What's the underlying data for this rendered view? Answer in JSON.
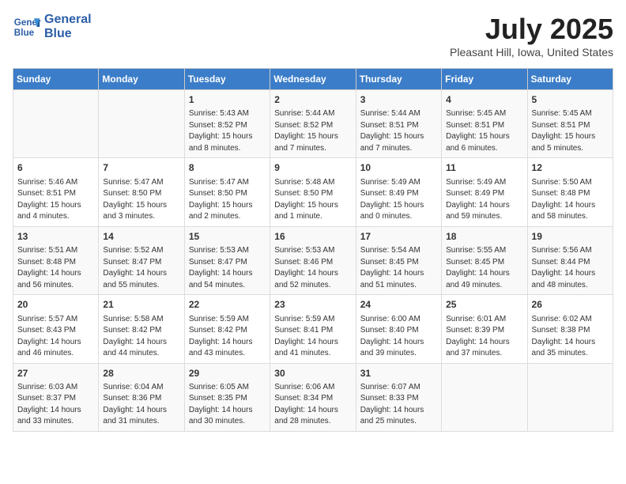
{
  "logo": {
    "line1": "General",
    "line2": "Blue"
  },
  "title": "July 2025",
  "location": "Pleasant Hill, Iowa, United States",
  "days_of_week": [
    "Sunday",
    "Monday",
    "Tuesday",
    "Wednesday",
    "Thursday",
    "Friday",
    "Saturday"
  ],
  "weeks": [
    [
      {
        "day": "",
        "info": ""
      },
      {
        "day": "",
        "info": ""
      },
      {
        "day": "1",
        "info": "Sunrise: 5:43 AM\nSunset: 8:52 PM\nDaylight: 15 hours and 8 minutes."
      },
      {
        "day": "2",
        "info": "Sunrise: 5:44 AM\nSunset: 8:52 PM\nDaylight: 15 hours and 7 minutes."
      },
      {
        "day": "3",
        "info": "Sunrise: 5:44 AM\nSunset: 8:51 PM\nDaylight: 15 hours and 7 minutes."
      },
      {
        "day": "4",
        "info": "Sunrise: 5:45 AM\nSunset: 8:51 PM\nDaylight: 15 hours and 6 minutes."
      },
      {
        "day": "5",
        "info": "Sunrise: 5:45 AM\nSunset: 8:51 PM\nDaylight: 15 hours and 5 minutes."
      }
    ],
    [
      {
        "day": "6",
        "info": "Sunrise: 5:46 AM\nSunset: 8:51 PM\nDaylight: 15 hours and 4 minutes."
      },
      {
        "day": "7",
        "info": "Sunrise: 5:47 AM\nSunset: 8:50 PM\nDaylight: 15 hours and 3 minutes."
      },
      {
        "day": "8",
        "info": "Sunrise: 5:47 AM\nSunset: 8:50 PM\nDaylight: 15 hours and 2 minutes."
      },
      {
        "day": "9",
        "info": "Sunrise: 5:48 AM\nSunset: 8:50 PM\nDaylight: 15 hours and 1 minute."
      },
      {
        "day": "10",
        "info": "Sunrise: 5:49 AM\nSunset: 8:49 PM\nDaylight: 15 hours and 0 minutes."
      },
      {
        "day": "11",
        "info": "Sunrise: 5:49 AM\nSunset: 8:49 PM\nDaylight: 14 hours and 59 minutes."
      },
      {
        "day": "12",
        "info": "Sunrise: 5:50 AM\nSunset: 8:48 PM\nDaylight: 14 hours and 58 minutes."
      }
    ],
    [
      {
        "day": "13",
        "info": "Sunrise: 5:51 AM\nSunset: 8:48 PM\nDaylight: 14 hours and 56 minutes."
      },
      {
        "day": "14",
        "info": "Sunrise: 5:52 AM\nSunset: 8:47 PM\nDaylight: 14 hours and 55 minutes."
      },
      {
        "day": "15",
        "info": "Sunrise: 5:53 AM\nSunset: 8:47 PM\nDaylight: 14 hours and 54 minutes."
      },
      {
        "day": "16",
        "info": "Sunrise: 5:53 AM\nSunset: 8:46 PM\nDaylight: 14 hours and 52 minutes."
      },
      {
        "day": "17",
        "info": "Sunrise: 5:54 AM\nSunset: 8:45 PM\nDaylight: 14 hours and 51 minutes."
      },
      {
        "day": "18",
        "info": "Sunrise: 5:55 AM\nSunset: 8:45 PM\nDaylight: 14 hours and 49 minutes."
      },
      {
        "day": "19",
        "info": "Sunrise: 5:56 AM\nSunset: 8:44 PM\nDaylight: 14 hours and 48 minutes."
      }
    ],
    [
      {
        "day": "20",
        "info": "Sunrise: 5:57 AM\nSunset: 8:43 PM\nDaylight: 14 hours and 46 minutes."
      },
      {
        "day": "21",
        "info": "Sunrise: 5:58 AM\nSunset: 8:42 PM\nDaylight: 14 hours and 44 minutes."
      },
      {
        "day": "22",
        "info": "Sunrise: 5:59 AM\nSunset: 8:42 PM\nDaylight: 14 hours and 43 minutes."
      },
      {
        "day": "23",
        "info": "Sunrise: 5:59 AM\nSunset: 8:41 PM\nDaylight: 14 hours and 41 minutes."
      },
      {
        "day": "24",
        "info": "Sunrise: 6:00 AM\nSunset: 8:40 PM\nDaylight: 14 hours and 39 minutes."
      },
      {
        "day": "25",
        "info": "Sunrise: 6:01 AM\nSunset: 8:39 PM\nDaylight: 14 hours and 37 minutes."
      },
      {
        "day": "26",
        "info": "Sunrise: 6:02 AM\nSunset: 8:38 PM\nDaylight: 14 hours and 35 minutes."
      }
    ],
    [
      {
        "day": "27",
        "info": "Sunrise: 6:03 AM\nSunset: 8:37 PM\nDaylight: 14 hours and 33 minutes."
      },
      {
        "day": "28",
        "info": "Sunrise: 6:04 AM\nSunset: 8:36 PM\nDaylight: 14 hours and 31 minutes."
      },
      {
        "day": "29",
        "info": "Sunrise: 6:05 AM\nSunset: 8:35 PM\nDaylight: 14 hours and 30 minutes."
      },
      {
        "day": "30",
        "info": "Sunrise: 6:06 AM\nSunset: 8:34 PM\nDaylight: 14 hours and 28 minutes."
      },
      {
        "day": "31",
        "info": "Sunrise: 6:07 AM\nSunset: 8:33 PM\nDaylight: 14 hours and 25 minutes."
      },
      {
        "day": "",
        "info": ""
      },
      {
        "day": "",
        "info": ""
      }
    ]
  ]
}
